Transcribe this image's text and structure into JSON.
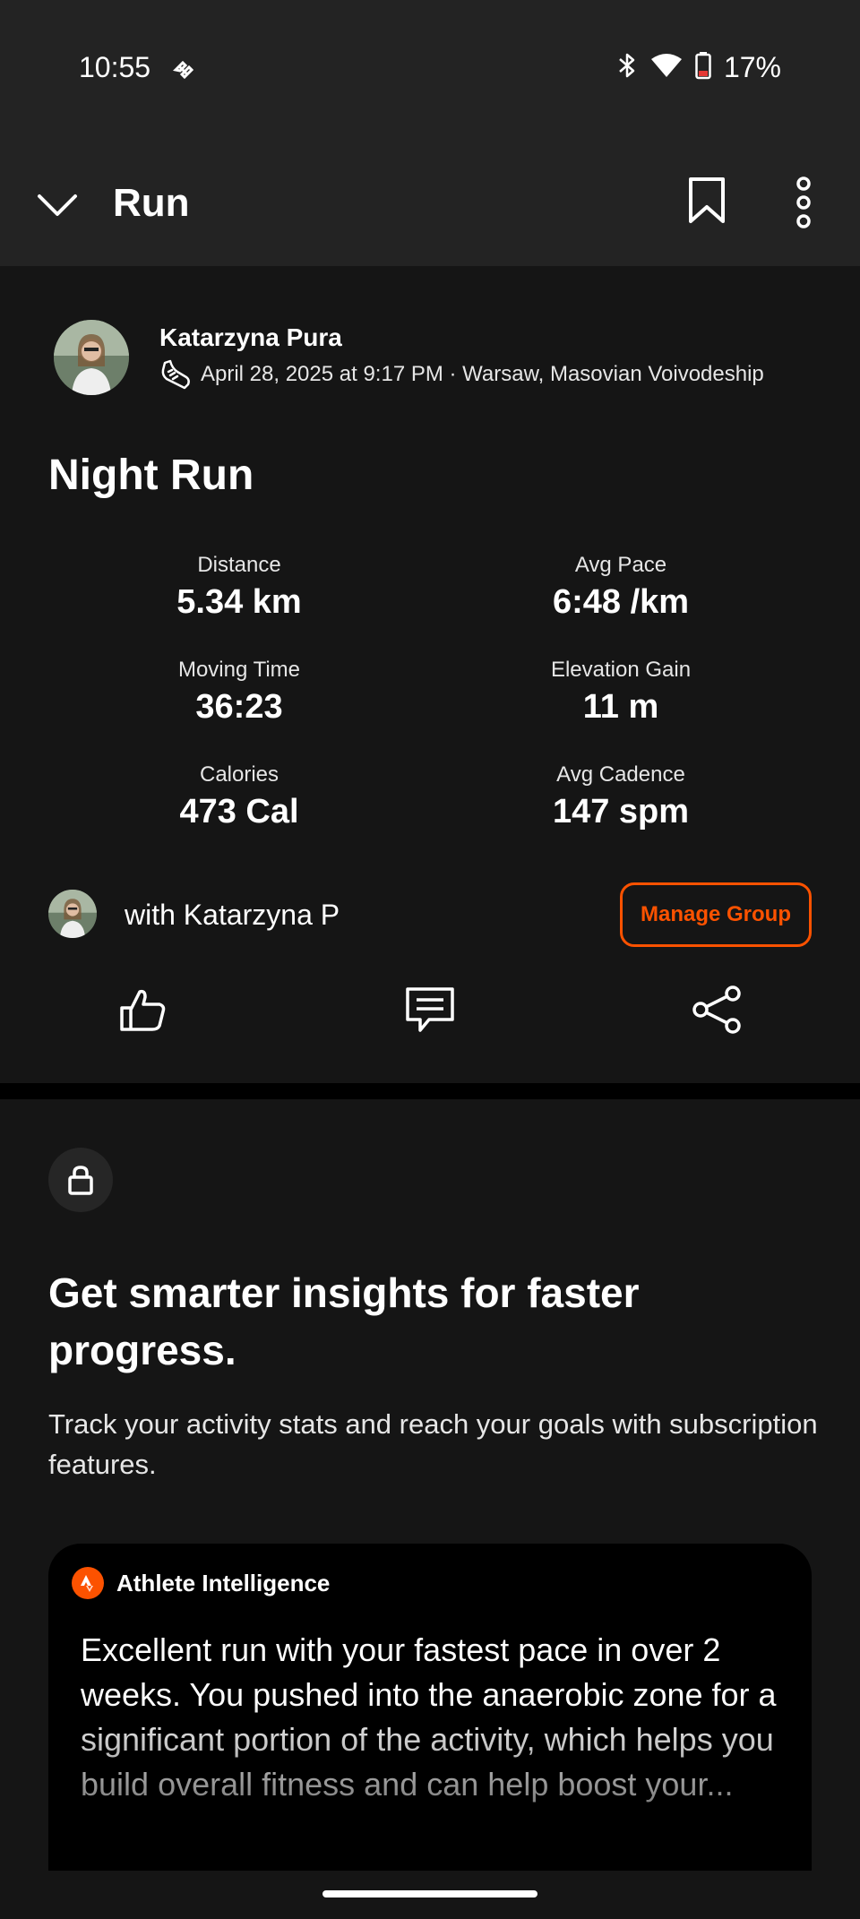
{
  "status_bar": {
    "time": "10:55",
    "battery": "17%"
  },
  "app_bar": {
    "title": "Run"
  },
  "activity": {
    "athlete_name": "Katarzyna Pura",
    "meta": "April 28, 2025 at 9:17 PM · Warsaw, Masovian Voivodeship",
    "title": "Night Run",
    "stats": [
      {
        "label": "Distance",
        "value": "5.34 km"
      },
      {
        "label": "Avg Pace",
        "value": "6:48 /km"
      },
      {
        "label": "Moving Time",
        "value": "36:23"
      },
      {
        "label": "Elevation Gain",
        "value": "11 m"
      },
      {
        "label": "Calories",
        "value": "473 Cal"
      },
      {
        "label": "Avg Cadence",
        "value": "147 spm"
      }
    ],
    "group_text": "with Katarzyna P",
    "manage_group_label": "Manage Group"
  },
  "upsell": {
    "headline": "Get smarter insights for faster progress.",
    "body": "Track your activity stats and reach your goals with subscription features.",
    "ai_title": "Athlete Intelligence",
    "ai_text": "Excellent run with your fastest pace in over 2 weeks. You pushed into the anaerobic zone for a significant portion of the activity, which helps you build overall fitness and can help boost your..."
  },
  "colors": {
    "accent": "#fc5200",
    "background": "#151515",
    "bar": "#232323"
  }
}
